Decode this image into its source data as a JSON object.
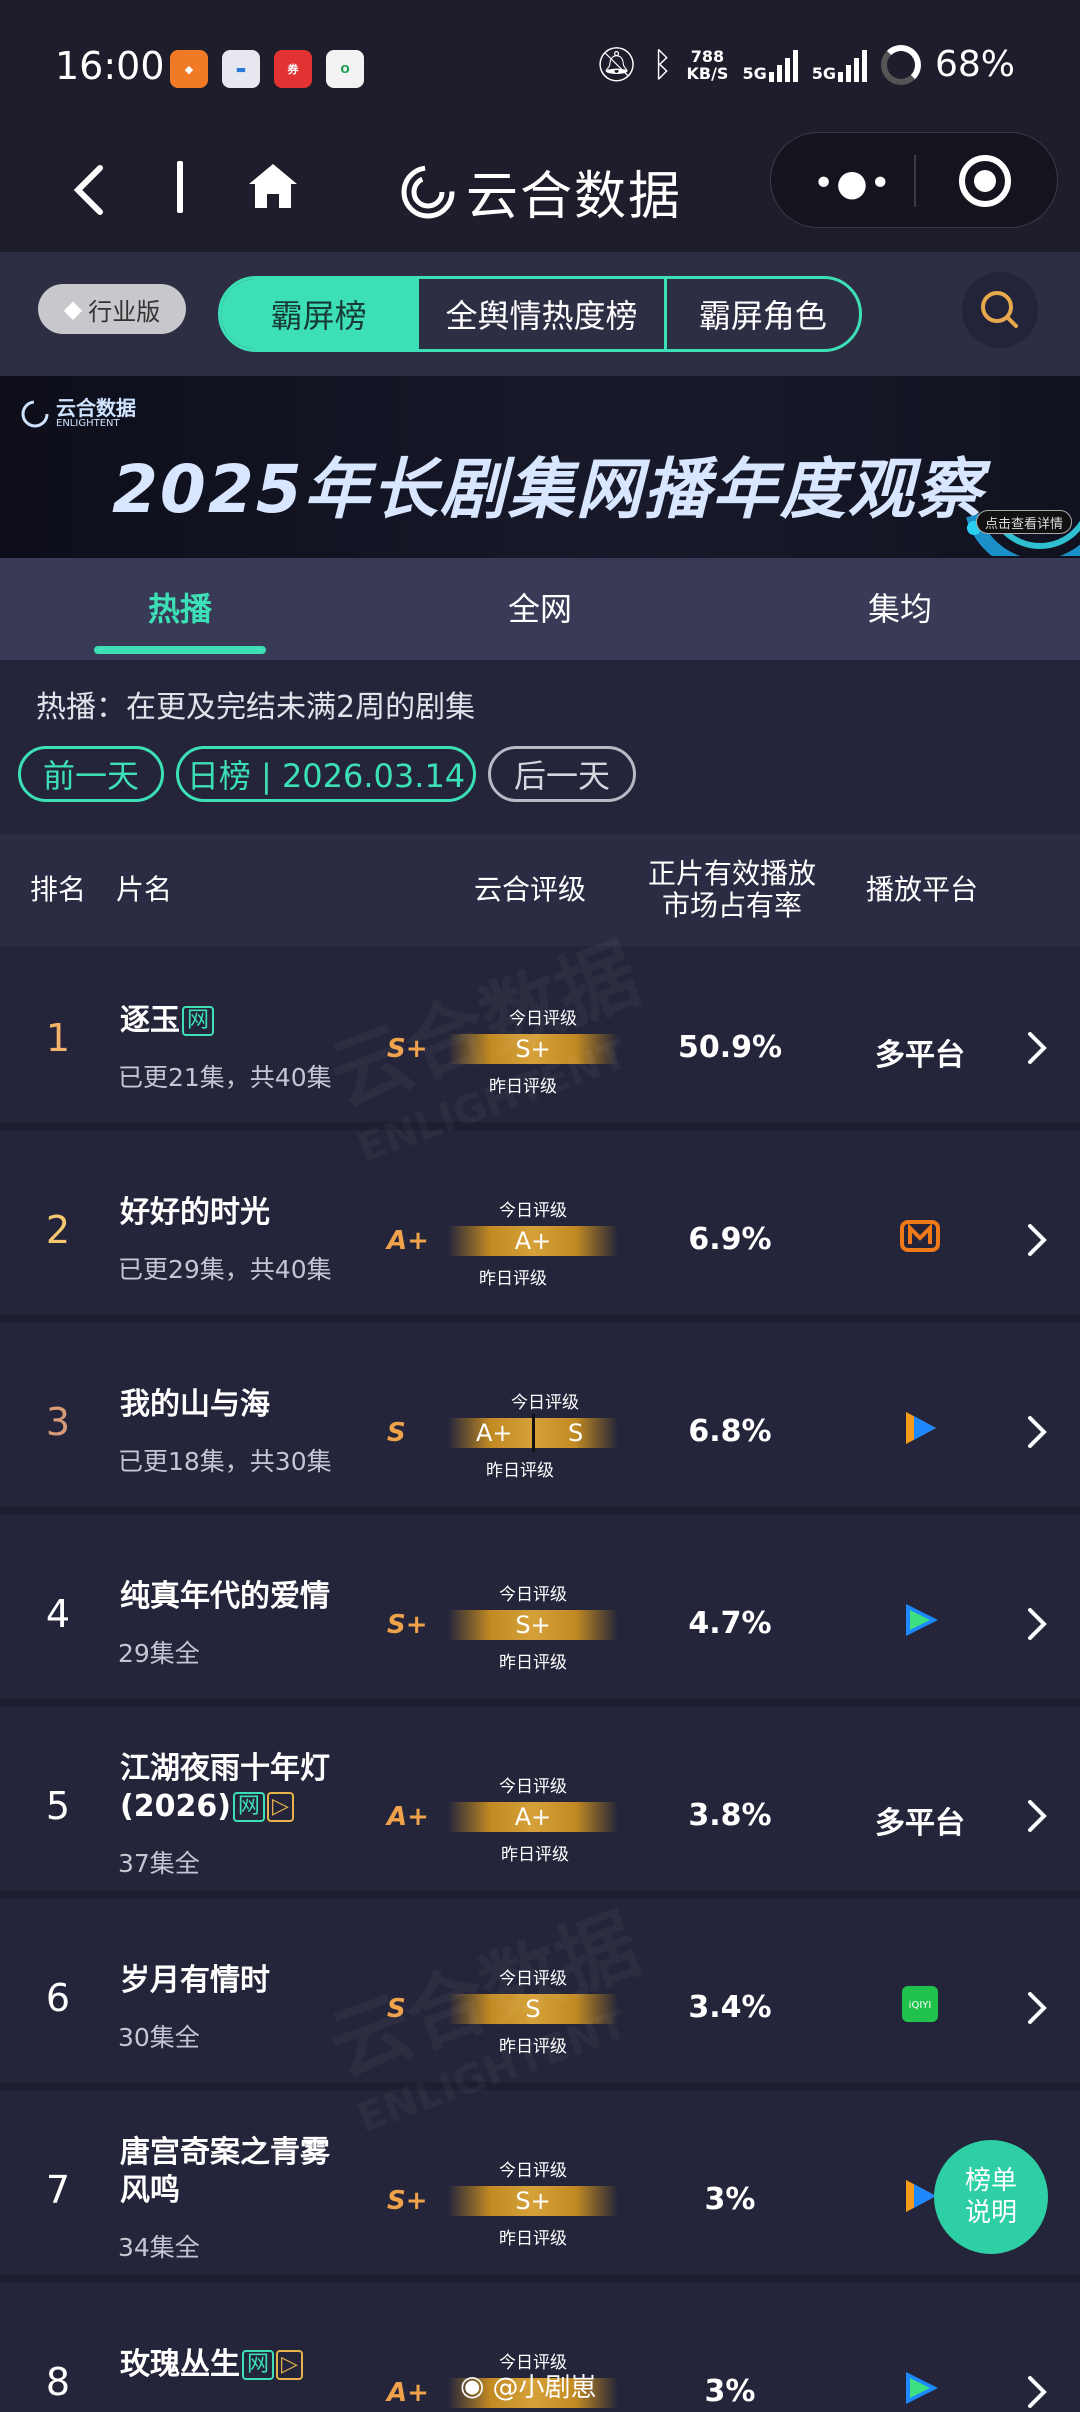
{
  "status": {
    "time": "16:00",
    "net_speed": "788",
    "net_unit": "KB/S",
    "sig1": "5G",
    "sig2": "5G",
    "battery": "68%",
    "app_icons": [
      "phone-manager-icon",
      "wallet-icon",
      "coupon-app-icon",
      "oppo-app-icon"
    ]
  },
  "nav": {
    "title": "云合数据"
  },
  "toptabs": {
    "industry": "行业版",
    "tabs": [
      "霸屏榜",
      "全舆情热度榜",
      "霸屏角色"
    ]
  },
  "banner": {
    "logo_title": "云合数据",
    "logo_sub": "ENLIGHTENT",
    "title": "2025年长剧集网播年度观察",
    "button": "点击查看详情"
  },
  "subtabs": [
    "热播",
    "全网",
    "集均"
  ],
  "description": "热播：在更及完结未满2周的剧集",
  "date_nav": {
    "prev": "前一天",
    "current": "日榜 | 2026.03.14",
    "next": "后一天"
  },
  "table_header": {
    "rank": "排名",
    "name": "片名",
    "rating": "云合评级",
    "share": "正片有效播放市场占有率",
    "platform": "播放平台"
  },
  "labels": {
    "today": "今日评级",
    "yesterday": "昨日评级"
  },
  "rows": [
    {
      "rank": "1",
      "title": "逐玉",
      "sub": "已更21集，共40集",
      "grade": "S+",
      "bar": "S+",
      "share": "50.9%",
      "platform": "多平台"
    },
    {
      "rank": "2",
      "title": "好好的时光",
      "sub": "已更29集，共40集",
      "grade": "A+",
      "bar": "A+",
      "share": "6.9%",
      "platform": ""
    },
    {
      "rank": "3",
      "title": "我的山与海",
      "sub": "已更18集，共30集",
      "grade": "S",
      "bar_left": "A+",
      "bar_right": "S",
      "share": "6.8%",
      "platform": ""
    },
    {
      "rank": "4",
      "title": "纯真年代的爱情",
      "sub": "29集全",
      "grade": "S+",
      "bar": "S+",
      "share": "4.7%",
      "platform": ""
    },
    {
      "rank": "5",
      "title": "江湖夜雨十年灯",
      "title2": "(2026)",
      "sub": "37集全",
      "grade": "A+",
      "bar": "A+",
      "share": "3.8%",
      "platform": "多平台"
    },
    {
      "rank": "6",
      "title": "岁月有情时",
      "sub": "30集全",
      "grade": "S",
      "bar": "S",
      "share": "3.4%",
      "platform": ""
    },
    {
      "rank": "7",
      "title": "唐宫奇案之青雾",
      "title2": "风鸣",
      "sub": "34集全",
      "grade": "S+",
      "bar": "S+",
      "share": "3%",
      "platform": ""
    },
    {
      "rank": "8",
      "title": "玫瑰丛生",
      "sub": "",
      "grade": "A+",
      "bar": "",
      "share": "3%",
      "platform": ""
    }
  ],
  "tags": {
    "net": "网",
    "play": "▷"
  },
  "float_button": "榜单说明",
  "weibo": "@小剧崽",
  "watermark": "云合数据",
  "watermark_sub": "ENLIGHTENT"
}
